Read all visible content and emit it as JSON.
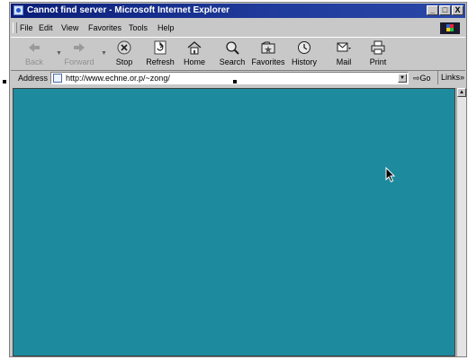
{
  "window": {
    "title": "Cannot find server - Microsoft Internet Explorer",
    "controls": [
      "_",
      "□",
      "X"
    ]
  },
  "menu": {
    "items": [
      "File",
      "Edit",
      "View",
      "Favorites",
      "Tools",
      "Help"
    ]
  },
  "toolbar": {
    "buttons": [
      {
        "label": "Back",
        "icon": "back-arrow-icon",
        "enabled": false
      },
      {
        "label": "Forward",
        "icon": "forward-arrow-icon",
        "enabled": false
      },
      {
        "label": "Stop",
        "icon": "stop-icon",
        "enabled": true
      },
      {
        "label": "Refresh",
        "icon": "refresh-icon",
        "enabled": true
      },
      {
        "label": "Home",
        "icon": "home-icon",
        "enabled": true
      },
      {
        "label": "Search",
        "icon": "search-icon",
        "enabled": true
      },
      {
        "label": "Favorites",
        "icon": "favorites-icon",
        "enabled": true
      },
      {
        "label": "History",
        "icon": "history-icon",
        "enabled": true
      },
      {
        "label": "Mail",
        "icon": "mail-icon",
        "enabled": true
      },
      {
        "label": "Print",
        "icon": "print-icon",
        "enabled": true
      }
    ]
  },
  "address": {
    "label": "Address",
    "url": "http://www.echne.or.p/~zong/",
    "go_label": "Go",
    "links_label": "Links"
  },
  "content": {
    "background": "#1e8a9e"
  }
}
